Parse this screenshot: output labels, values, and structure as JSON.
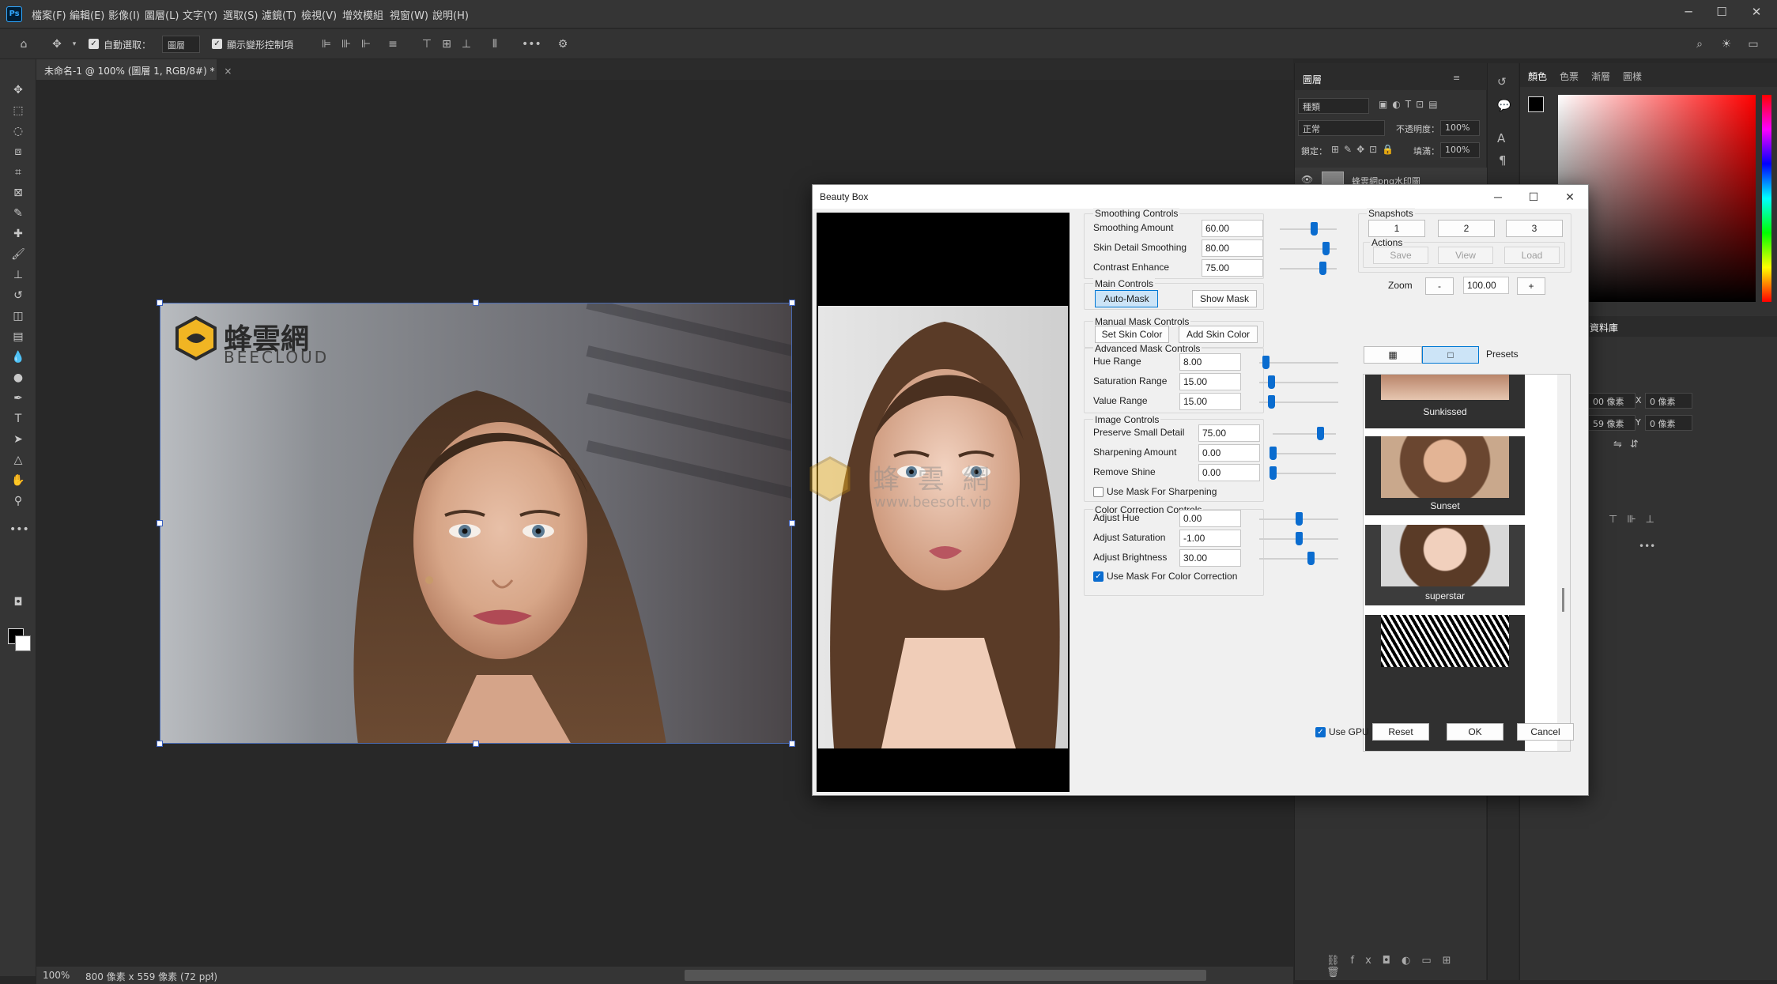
{
  "menu": [
    "檔案(F)",
    "編輯(E)",
    "影像(I)",
    "圖層(L)",
    "文字(Y)",
    "選取(S)",
    "濾鏡(T)",
    "檢視(V)",
    "增效模組",
    "視窗(W)",
    "說明(H)"
  ],
  "options_bar": {
    "auto_select_label": "自動選取：",
    "auto_select_value": "圖層",
    "show_transform_label": "顯示變形控制項"
  },
  "document_tab": {
    "title": "未命名-1 @ 100% (圖層 1, RGB/8#) *",
    "close": "×"
  },
  "status_bar": {
    "zoom": "100%",
    "doc_info": "800 像素 x 559 像素 (72 ppi)",
    "arrow": "›"
  },
  "canvas_logo": {
    "brand_cn": "蜂雲網",
    "brand_en": "BEECLOUD"
  },
  "layers_panel": {
    "tab": "圖層",
    "kind_filter": "種類",
    "blend_mode": "正常",
    "opacity_label": "不透明度：",
    "opacity_value": "100%",
    "lock_label": "鎖定：",
    "fill_label": "填滿：",
    "fill_value": "100%",
    "layer_name": "蜂雲網png水印圖"
  },
  "color_panel": {
    "tabs": [
      "顏色",
      "色票",
      "漸層",
      "圖樣"
    ],
    "active_tab": "顏色",
    "accent": "#ff0000"
  },
  "props_panel": {
    "tab": "資料庫",
    "w_value": "00 像素",
    "x_label": "X",
    "x_value": "0 像素",
    "h_value": "59 像素",
    "y_label": "Y",
    "y_value": "0 像素",
    "more": "•••"
  },
  "dialog": {
    "title": "Beauty Box",
    "smoothing": {
      "title": "Smoothing Controls",
      "rows": [
        {
          "label": "Smoothing Amount",
          "value": "60.00",
          "fraction": 0.6
        },
        {
          "label": "Skin Detail Smoothing",
          "value": "80.00",
          "fraction": 0.8
        },
        {
          "label": "Contrast Enhance",
          "value": "75.00",
          "fraction": 0.75
        }
      ]
    },
    "main_controls": {
      "title": "Main Controls",
      "auto_mask": "Auto-Mask",
      "show_mask": "Show Mask"
    },
    "manual_mask": {
      "title": "Manual Mask Controls",
      "set_skin": "Set Skin Color",
      "add_skin": "Add Skin Color"
    },
    "advanced_mask": {
      "title": "Advanced Mask Controls",
      "rows": [
        {
          "label": "Hue Range",
          "value": "8.00",
          "fraction": 0.08
        },
        {
          "label": "Saturation Range",
          "value": "15.00",
          "fraction": 0.15
        },
        {
          "label": "Value Range",
          "value": "15.00",
          "fraction": 0.15
        }
      ]
    },
    "image_controls": {
      "title": "Image Controls",
      "rows": [
        {
          "label": "Preserve Small Detail",
          "value": "75.00",
          "fraction": 0.75
        },
        {
          "label": "Sharpening Amount",
          "value": "0.00",
          "fraction": 0.0
        },
        {
          "label": "Remove Shine",
          "value": "0.00",
          "fraction": 0.0
        }
      ],
      "use_mask_sharpening": "Use Mask For Sharpening",
      "use_mask_sharpening_checked": false
    },
    "color_correction": {
      "title": "Color Correction Controls",
      "rows": [
        {
          "label": "Adjust Hue",
          "value": "0.00",
          "fraction": 0.5
        },
        {
          "label": "Adjust Saturation",
          "value": "-1.00",
          "fraction": 0.495
        },
        {
          "label": "Adjust Brightness",
          "value": "30.00",
          "fraction": 0.65
        }
      ],
      "use_mask_color": "Use Mask For Color Correction",
      "use_mask_color_checked": true
    },
    "snapshots": {
      "title": "Snapshots",
      "buttons": [
        "1",
        "2",
        "3"
      ],
      "actions_title": "Actions",
      "save": "Save",
      "view": "View",
      "load": "Load"
    },
    "zoom": {
      "label": "Zoom",
      "minus": "-",
      "value": "100.00",
      "plus": "+"
    },
    "view_toggle": {
      "grid": "▦",
      "single": "□"
    },
    "presets": {
      "label": "Presets",
      "items": [
        "Sunkissed",
        "Sunset",
        "superstar"
      ]
    },
    "footer": {
      "use_gpu": "Use GPU",
      "use_gpu_checked": true,
      "reset": "Reset",
      "ok": "OK",
      "cancel": "Cancel"
    }
  },
  "watermark": {
    "cn": "蜂 雲 網",
    "url": "www.beesoft.vip"
  }
}
